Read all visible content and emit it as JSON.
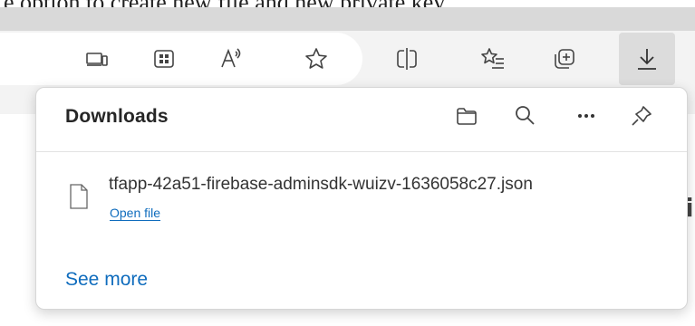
{
  "background_page": {
    "visible_text": "e option to create new file and new private key."
  },
  "toolbar": {
    "icons": [
      {
        "name": "app-available-icon"
      },
      {
        "name": "immersive-reader-icon"
      },
      {
        "name": "read-aloud-icon"
      },
      {
        "name": "favorite-star-icon"
      },
      {
        "name": "split-screen-icon"
      },
      {
        "name": "favorites-list-icon"
      },
      {
        "name": "collections-icon"
      },
      {
        "name": "download-icon"
      }
    ]
  },
  "downloads_panel": {
    "title": "Downloads",
    "header_icons": [
      "open-folder-icon",
      "search-icon",
      "more-options-icon",
      "pin-icon"
    ],
    "items": [
      {
        "file_name": "tfapp-42a51-firebase-adminsdk-wuizv-1636058c27.json",
        "action": "Open file"
      }
    ],
    "see_more": "See more"
  },
  "colors": {
    "toolbar_bg": "#f3f3f3",
    "active_button_bg": "#dcdcdc",
    "link": "#0f6cbd",
    "text": "#262626"
  }
}
